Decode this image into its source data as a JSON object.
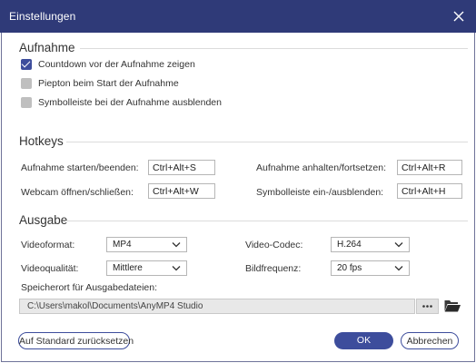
{
  "window": {
    "title": "Einstellungen"
  },
  "recording": {
    "heading": "Aufnahme",
    "options": [
      {
        "label": "Countdown vor der Aufnahme zeigen",
        "checked": true
      },
      {
        "label": "Piepton beim Start der Aufnahme",
        "checked": false
      },
      {
        "label": "Symbolleiste bei der Aufnahme ausblenden",
        "checked": false
      }
    ]
  },
  "hotkeys": {
    "heading": "Hotkeys",
    "items": [
      {
        "label": "Aufnahme starten/beenden:",
        "value": "Ctrl+Alt+S"
      },
      {
        "label": "Aufnahme anhalten/fortsetzen:",
        "value": "Ctrl+Alt+R"
      },
      {
        "label": "Webcam öffnen/schließen:",
        "value": "Ctrl+Alt+W"
      },
      {
        "label": "Symbolleiste ein-/ausblenden:",
        "value": "Ctrl+Alt+H"
      }
    ]
  },
  "output": {
    "heading": "Ausgabe",
    "video_format": {
      "label": "Videoformat:",
      "value": "MP4"
    },
    "video_codec": {
      "label": "Video-Codec:",
      "value": "H.264"
    },
    "video_quality": {
      "label": "Videoqualität:",
      "value": "Mittlere"
    },
    "frame_rate": {
      "label": "Bildfrequenz:",
      "value": "20 fps"
    },
    "save_location": {
      "label": "Speicherort für Ausgabedateien:",
      "path": "C:\\Users\\makol\\Documents\\AnyMP4 Studio"
    }
  },
  "footer": {
    "reset_label": "Auf Standard zurücksetzen",
    "ok_label": "OK",
    "cancel_label": "Abbrechen"
  },
  "colors": {
    "titlebar": "#2f3a78",
    "accent": "#3d4d9c",
    "checkbox_off": "#bfbfbf"
  },
  "icons": {
    "close": "close-icon",
    "dropdown": "chevron-down-icon",
    "browse": "more-dots-icon",
    "open_folder": "folder-icon"
  }
}
